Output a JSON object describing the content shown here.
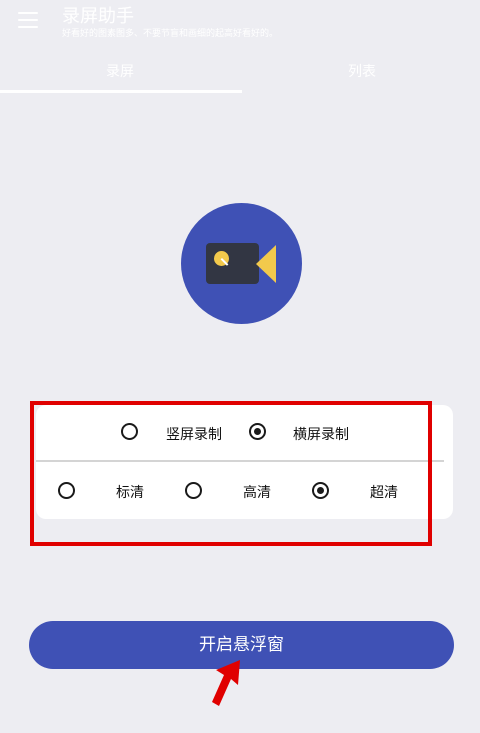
{
  "header": {
    "title": "录屏助手",
    "subtitle": "好看好的图素图多、不要节盲和画细的起高好看好的。"
  },
  "tabs": [
    {
      "label": "录屏",
      "active": true
    },
    {
      "label": "列表",
      "active": false
    }
  ],
  "orientation": {
    "options": [
      {
        "label": "竖屏录制",
        "selected": false
      },
      {
        "label": "横屏录制",
        "selected": true
      }
    ]
  },
  "quality": {
    "options": [
      {
        "label": "标清",
        "selected": false
      },
      {
        "label": "高清",
        "selected": false
      },
      {
        "label": "超清",
        "selected": true
      }
    ]
  },
  "actions": {
    "float_window_label": "开启悬浮窗"
  },
  "colors": {
    "primary": "#3f51b5",
    "background": "#ededf2",
    "camera_accent": "#f2c94c",
    "camera_body": "#323643",
    "highlight": "#e00000"
  },
  "icons": {
    "menu": "hamburger-menu-icon",
    "logo": "video-camera-icon",
    "annotation": "red-arrow-icon"
  }
}
